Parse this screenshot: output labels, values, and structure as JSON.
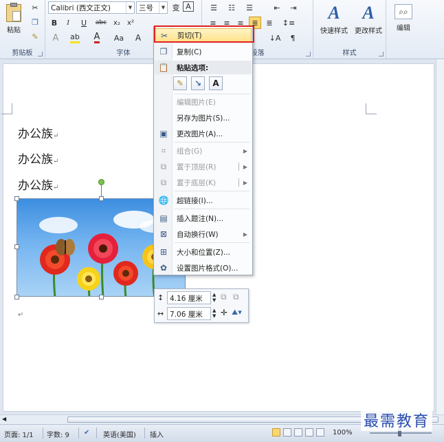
{
  "ribbon": {
    "clipboard": {
      "label": "剪贴板",
      "paste_label": "粘贴"
    },
    "font": {
      "label": "字体",
      "font_name": "Calibri (西文正文)",
      "font_size": "三号",
      "bold": "B",
      "italic": "I",
      "underline": "U",
      "strike": "abc",
      "subscript": "x₂",
      "superscript": "x²",
      "font_color": "A",
      "change_case": "Aa",
      "grow": "A",
      "phonetic": "变",
      "border_char": "A"
    },
    "paragraph": {
      "label": "段落"
    },
    "styles": {
      "label": "样式",
      "quick_styles": "快速样式",
      "change_styles": "更改样式"
    },
    "editing": {
      "label": "编辑"
    }
  },
  "document": {
    "lines": [
      "办公族",
      "办公族",
      "办公族"
    ]
  },
  "context_menu": {
    "items": [
      {
        "label": "剪切(T)",
        "enabled": true,
        "icon": "scissors-icon"
      },
      {
        "label": "复制(C)",
        "enabled": true,
        "icon": "copy-icon"
      },
      {
        "label": "粘贴选项:",
        "enabled": true,
        "icon": "paste-icon"
      },
      {
        "label": "编辑图片(E)",
        "enabled": false,
        "icon": ""
      },
      {
        "label": "另存为图片(S)...",
        "enabled": true,
        "icon": ""
      },
      {
        "label": "更改图片(A)...",
        "enabled": true,
        "icon": "change-picture-icon"
      },
      {
        "label": "组合(G)",
        "enabled": false,
        "icon": "group-icon"
      },
      {
        "label": "置于顶层(R)",
        "enabled": false,
        "icon": "bring-front-icon"
      },
      {
        "label": "置于底层(K)",
        "enabled": false,
        "icon": "send-back-icon"
      },
      {
        "label": "超链接(I)...",
        "enabled": true,
        "icon": "hyperlink-icon"
      },
      {
        "label": "插入题注(N)...",
        "enabled": true,
        "icon": "caption-icon"
      },
      {
        "label": "自动换行(W)",
        "enabled": true,
        "icon": "wrap-text-icon"
      },
      {
        "label": "大小和位置(Z)...",
        "enabled": true,
        "icon": "size-position-icon"
      },
      {
        "label": "设置图片格式(O)...",
        "enabled": true,
        "icon": "format-picture-icon"
      }
    ],
    "paste_buttons": [
      "keep-source",
      "merge",
      "A"
    ]
  },
  "mini_toolbar": {
    "height_value": "4.16 厘米",
    "width_value": "7.06 厘米"
  },
  "status_bar": {
    "page": "页面: 1/1",
    "words": "字数: 9",
    "language": "英语(美国)",
    "mode": "插入",
    "zoom": "100%"
  },
  "watermark": "最需教育",
  "colors": {
    "accent": "#2f5fa8",
    "highlight_border": "#e12020",
    "menu_hover": "#ffe38a"
  }
}
